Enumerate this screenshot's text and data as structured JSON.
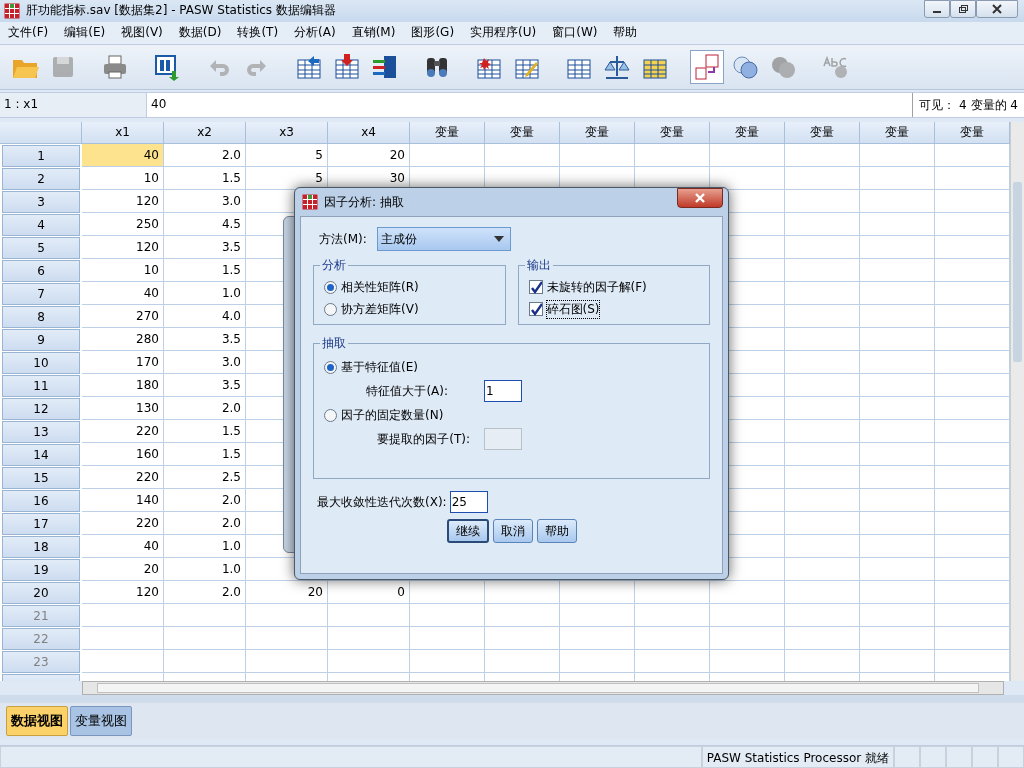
{
  "window": {
    "title": "肝功能指标.sav [数据集2] - PASW Statistics 数据编辑器"
  },
  "menu": [
    "文件(F)",
    "编辑(E)",
    "视图(V)",
    "数据(D)",
    "转换(T)",
    "分析(A)",
    "直销(M)",
    "图形(G)",
    "实用程序(U)",
    "窗口(W)",
    "帮助"
  ],
  "toolbar": [
    {
      "kind": "open",
      "disabled": false,
      "on": false
    },
    {
      "kind": "save",
      "disabled": true,
      "on": false
    },
    {
      "kind": "print",
      "disabled": false,
      "on": false
    },
    {
      "kind": "recall",
      "disabled": false,
      "on": false
    },
    {
      "kind": "undo",
      "disabled": true,
      "on": false
    },
    {
      "kind": "redo",
      "disabled": true,
      "on": false
    },
    {
      "kind": "gotocase",
      "disabled": false,
      "on": false
    },
    {
      "kind": "gotovar",
      "disabled": false,
      "on": false
    },
    {
      "kind": "variables",
      "disabled": false,
      "on": false
    },
    {
      "kind": "find",
      "disabled": false,
      "on": false
    },
    {
      "kind": "insertcase",
      "disabled": false,
      "on": false
    },
    {
      "kind": "insertvar",
      "disabled": false,
      "on": false
    },
    {
      "kind": "split",
      "disabled": false,
      "on": false
    },
    {
      "kind": "weight",
      "disabled": false,
      "on": false
    },
    {
      "kind": "select",
      "disabled": false,
      "on": false
    },
    {
      "kind": "labels",
      "disabled": false,
      "on": true
    },
    {
      "kind": "sets",
      "disabled": false,
      "on": false
    },
    {
      "kind": "allvars",
      "disabled": true,
      "on": false
    },
    {
      "kind": "spell",
      "disabled": true,
      "on": false
    }
  ],
  "cell_editor": {
    "cell_ref": "1 : x1",
    "value": "40",
    "visible_count": "可见： 4 变量的 4"
  },
  "grid": {
    "columns": [
      "x1",
      "x2",
      "x3",
      "x4",
      "变量",
      "变量",
      "变量",
      "变量",
      "变量",
      "变量",
      "变量",
      "变量"
    ],
    "rows": [
      {
        "number": "1",
        "empty": false,
        "cells": [
          {
            "v": "40",
            "selected": true
          },
          {
            "v": "2.0",
            "selected": false
          },
          {
            "v": "5",
            "selected": false
          },
          {
            "v": "20",
            "selected": false
          }
        ]
      },
      {
        "number": "2",
        "empty": false,
        "cells": [
          {
            "v": "10",
            "selected": false
          },
          {
            "v": "1.5",
            "selected": false
          },
          {
            "v": "5",
            "selected": false
          },
          {
            "v": "30",
            "selected": false
          }
        ]
      },
      {
        "number": "3",
        "empty": false,
        "cells": [
          {
            "v": "120",
            "selected": false
          },
          {
            "v": "3.0",
            "selected": false
          }
        ]
      },
      {
        "number": "4",
        "empty": false,
        "cells": [
          {
            "v": "250",
            "selected": false
          },
          {
            "v": "4.5",
            "selected": false
          }
        ]
      },
      {
        "number": "5",
        "empty": false,
        "cells": [
          {
            "v": "120",
            "selected": false
          },
          {
            "v": "3.5",
            "selected": false
          }
        ]
      },
      {
        "number": "6",
        "empty": false,
        "cells": [
          {
            "v": "10",
            "selected": false
          },
          {
            "v": "1.5",
            "selected": false
          }
        ]
      },
      {
        "number": "7",
        "empty": false,
        "cells": [
          {
            "v": "40",
            "selected": false
          },
          {
            "v": "1.0",
            "selected": false
          }
        ]
      },
      {
        "number": "8",
        "empty": false,
        "cells": [
          {
            "v": "270",
            "selected": false
          },
          {
            "v": "4.0",
            "selected": false
          }
        ]
      },
      {
        "number": "9",
        "empty": false,
        "cells": [
          {
            "v": "280",
            "selected": false
          },
          {
            "v": "3.5",
            "selected": false
          }
        ]
      },
      {
        "number": "10",
        "empty": false,
        "cells": [
          {
            "v": "170",
            "selected": false
          },
          {
            "v": "3.0",
            "selected": false
          }
        ]
      },
      {
        "number": "11",
        "empty": false,
        "cells": [
          {
            "v": "180",
            "selected": false
          },
          {
            "v": "3.5",
            "selected": false
          }
        ]
      },
      {
        "number": "12",
        "empty": false,
        "cells": [
          {
            "v": "130",
            "selected": false
          },
          {
            "v": "2.0",
            "selected": false
          }
        ]
      },
      {
        "number": "13",
        "empty": false,
        "cells": [
          {
            "v": "220",
            "selected": false
          },
          {
            "v": "1.5",
            "selected": false
          }
        ]
      },
      {
        "number": "14",
        "empty": false,
        "cells": [
          {
            "v": "160",
            "selected": false
          },
          {
            "v": "1.5",
            "selected": false
          }
        ]
      },
      {
        "number": "15",
        "empty": false,
        "cells": [
          {
            "v": "220",
            "selected": false
          },
          {
            "v": "2.5",
            "selected": false
          }
        ]
      },
      {
        "number": "16",
        "empty": false,
        "cells": [
          {
            "v": "140",
            "selected": false
          },
          {
            "v": "2.0",
            "selected": false
          }
        ]
      },
      {
        "number": "17",
        "empty": false,
        "cells": [
          {
            "v": "220",
            "selected": false
          },
          {
            "v": "2.0",
            "selected": false
          }
        ]
      },
      {
        "number": "18",
        "empty": false,
        "cells": [
          {
            "v": "40",
            "selected": false
          },
          {
            "v": "1.0",
            "selected": false
          }
        ]
      },
      {
        "number": "19",
        "empty": false,
        "cells": [
          {
            "v": "20",
            "selected": false
          },
          {
            "v": "1.0",
            "selected": false
          }
        ]
      },
      {
        "number": "20",
        "empty": false,
        "cells": [
          {
            "v": "120",
            "selected": false
          },
          {
            "v": "2.0",
            "selected": false
          },
          {
            "v": "20",
            "selected": false
          },
          {
            "v": "0",
            "selected": false
          }
        ]
      },
      {
        "number": "21",
        "empty": true
      },
      {
        "number": "22",
        "empty": true
      },
      {
        "number": "23",
        "empty": true
      }
    ]
  },
  "dialog": {
    "title": "因子分析: 抽取",
    "method_label": "方法(M):",
    "method_value": "主成份",
    "analysis": {
      "title": "分析",
      "options": [
        {
          "label": "相关性矩阵(R)",
          "selected": true
        },
        {
          "label": "协方差矩阵(V)",
          "selected": false
        }
      ]
    },
    "output": {
      "title": "输出",
      "options": [
        {
          "label": "未旋转的因子解(F)",
          "checked": true,
          "focused": false
        },
        {
          "label": "碎石图(S)",
          "checked": true,
          "focused": true
        }
      ]
    },
    "extract": {
      "title": "抽取",
      "options": [
        {
          "label": "基于特征值(E)",
          "selected": true,
          "field_label": "特征值大于(A):",
          "field_value": "1",
          "field_disabled": false
        },
        {
          "label": "因子的固定数量(N)",
          "selected": false,
          "field_label": "要提取的因子(T):",
          "field_disabled": true
        }
      ]
    },
    "iterations_label": "最大收敛性迭代次数(X):",
    "iterations_value": "25",
    "buttons": [
      {
        "label": "继续",
        "default": true
      },
      {
        "label": "取消",
        "default": false
      },
      {
        "label": "帮助",
        "default": false
      }
    ]
  },
  "view_tabs": [
    {
      "label": "数据视图",
      "selected": true
    },
    {
      "label": "变量视图",
      "selected": false
    }
  ],
  "status_bar": {
    "text": "PASW Statistics Processor 就绪"
  }
}
